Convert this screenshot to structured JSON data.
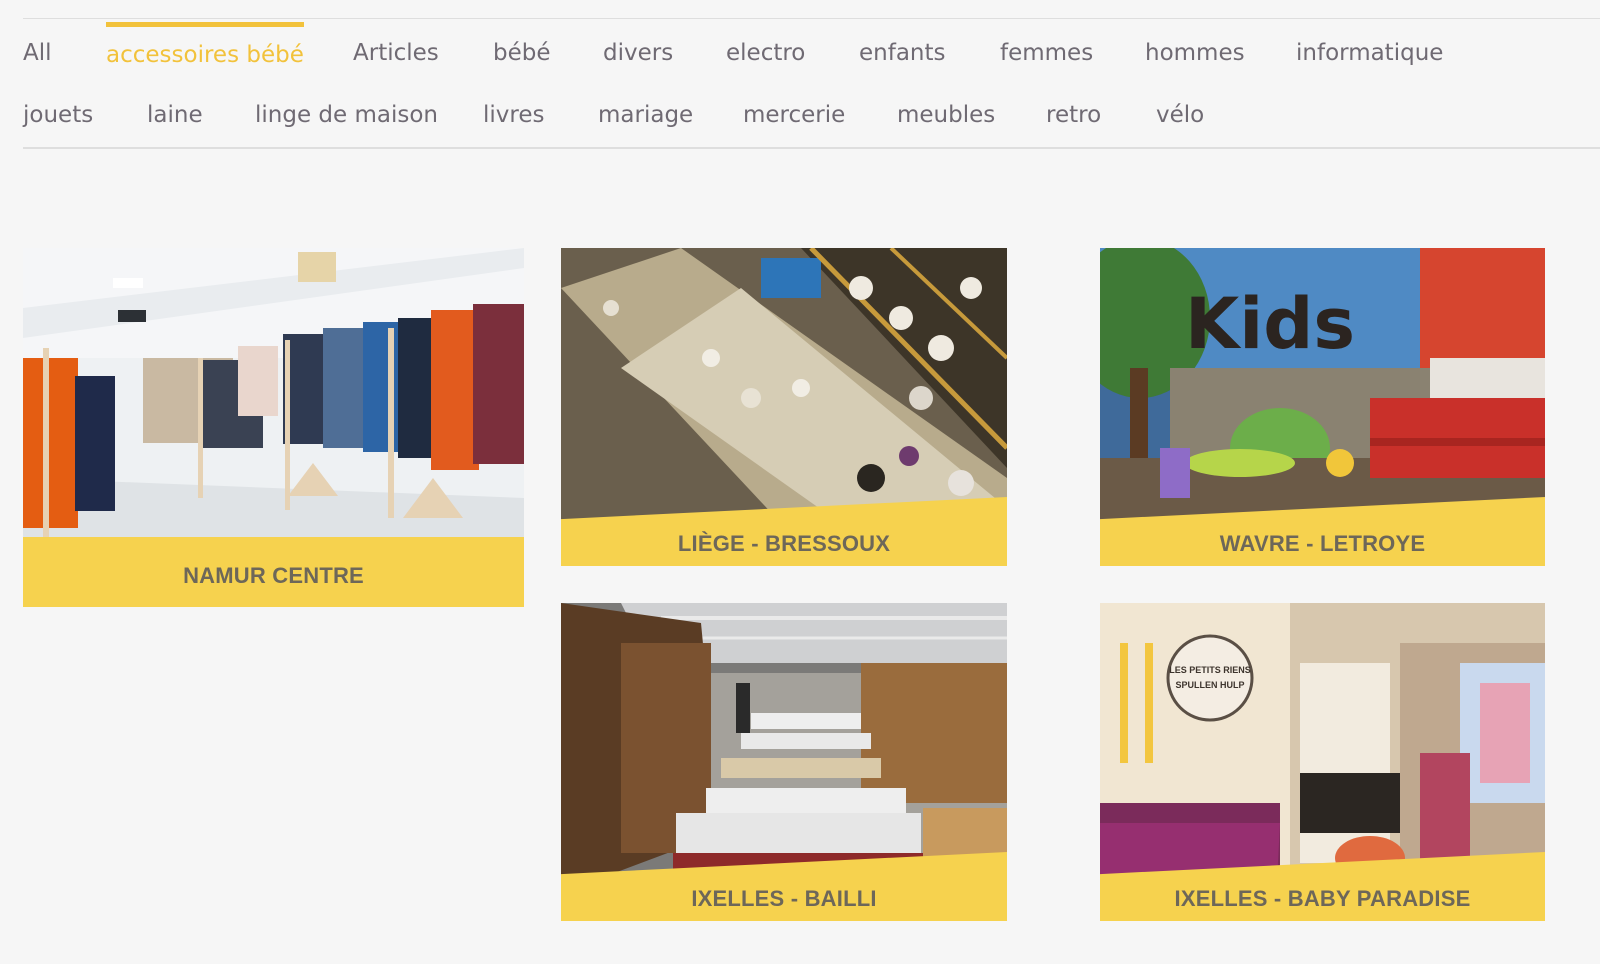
{
  "filters": [
    {
      "label": "All",
      "active": false
    },
    {
      "label": "accessoires bébé",
      "active": true
    },
    {
      "label": "Articles",
      "active": false
    },
    {
      "label": "bébé",
      "active": false
    },
    {
      "label": "divers",
      "active": false
    },
    {
      "label": "electro",
      "active": false
    },
    {
      "label": "enfants",
      "active": false
    },
    {
      "label": "femmes",
      "active": false
    },
    {
      "label": "hommes",
      "active": false
    },
    {
      "label": "informatique",
      "active": false
    },
    {
      "label": "jouets",
      "active": false
    },
    {
      "label": "laine",
      "active": false
    },
    {
      "label": "linge de maison",
      "active": false
    },
    {
      "label": "livres",
      "active": false
    },
    {
      "label": "mariage",
      "active": false
    },
    {
      "label": "mercerie",
      "active": false
    },
    {
      "label": "meubles",
      "active": false
    },
    {
      "label": "retro",
      "active": false
    },
    {
      "label": "vélo",
      "active": false
    }
  ],
  "stores": [
    {
      "label": "NAMUR CENTRE",
      "photo": "clothing-racks-store"
    },
    {
      "label": "LIÈGE - BRESSOUX",
      "photo": "tableware-shelves"
    },
    {
      "label": "WAVRE - LETROYE",
      "photo": "kids-corner-mural",
      "mural_text": "Kids"
    },
    {
      "label": "IXELLES - BAILLI",
      "photo": "furniture-beds-hall"
    },
    {
      "label": "IXELLES - BABY PARADISE",
      "photo": "baby-shop-interior",
      "sign_text": "LES PETITS RIENS SPULLEN HULP"
    }
  ],
  "colors": {
    "accent": "#f2c23b",
    "label_band": "#f6d24e",
    "filter_text": "#6f6a73",
    "background": "#f6f6f6"
  }
}
